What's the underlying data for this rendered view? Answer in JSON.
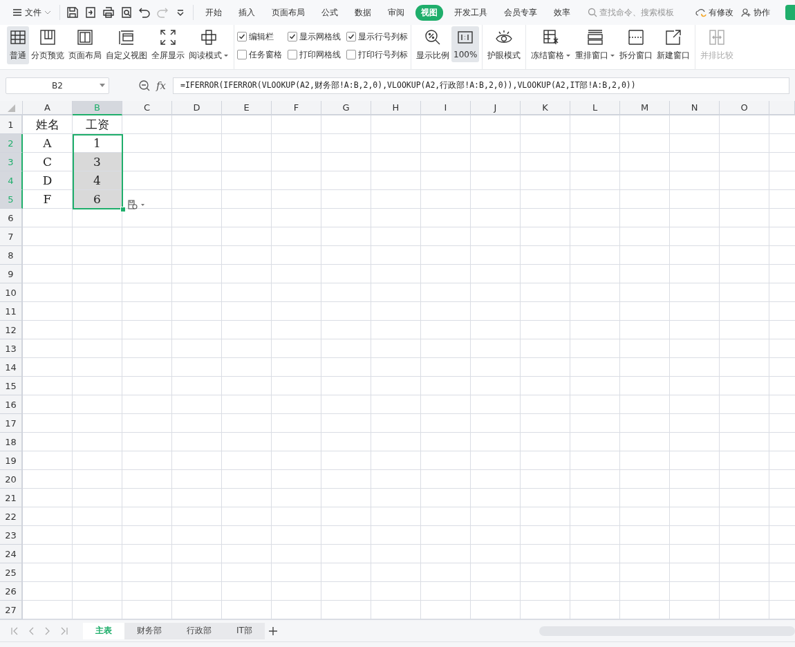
{
  "menu": {
    "file": "文件",
    "tabs": [
      {
        "label": "开始",
        "selected": false
      },
      {
        "label": "插入",
        "selected": false
      },
      {
        "label": "页面布局",
        "selected": false
      },
      {
        "label": "公式",
        "selected": false
      },
      {
        "label": "数据",
        "selected": false
      },
      {
        "label": "审阅",
        "selected": false
      },
      {
        "label": "视图",
        "selected": true
      },
      {
        "label": "开发工具",
        "selected": false
      },
      {
        "label": "会员专享",
        "selected": false
      },
      {
        "label": "效率",
        "selected": false
      }
    ],
    "search": {
      "placeholder": "查找命令、搜索模板"
    },
    "actions": [
      {
        "kind": "sync",
        "label": "有修改"
      },
      {
        "kind": "share",
        "label": "协作"
      }
    ]
  },
  "ribbon": {
    "groups": [
      {
        "kind": "buttons",
        "items": [
          {
            "kind": "grid",
            "label": "普通",
            "selected": true,
            "dropdown": false,
            "disabled": false
          },
          {
            "kind": "pagebreak",
            "label": "分页预览",
            "selected": false,
            "dropdown": false,
            "disabled": false
          },
          {
            "kind": "layout",
            "label": "页面布局",
            "selected": false,
            "dropdown": false,
            "disabled": false
          },
          {
            "kind": "custom",
            "label": "自定义视图",
            "selected": false,
            "dropdown": false,
            "disabled": false
          },
          {
            "kind": "fullscreen",
            "label": "全屏显示",
            "selected": false,
            "dropdown": false,
            "disabled": false
          },
          {
            "kind": "reading",
            "label": "阅读模式",
            "selected": false,
            "dropdown": true,
            "disabled": false
          }
        ]
      },
      {
        "kind": "checks",
        "items": [
          {
            "label": "编辑栏",
            "checked": true
          },
          {
            "label": "任务窗格",
            "checked": false
          },
          {
            "label": "显示网格线",
            "checked": true
          },
          {
            "label": "打印网格线",
            "checked": false
          },
          {
            "label": "显示行号列标",
            "checked": true
          },
          {
            "label": "打印行号列标",
            "checked": false
          }
        ]
      },
      {
        "kind": "buttons",
        "items": [
          {
            "kind": "zoom",
            "label": "显示比例",
            "selected": false,
            "dropdown": false,
            "disabled": false
          },
          {
            "kind": "actual",
            "label": "100%",
            "selected": true,
            "dropdown": false,
            "disabled": false
          }
        ]
      },
      {
        "kind": "buttons",
        "items": [
          {
            "kind": "eye",
            "label": "护眼模式",
            "selected": false,
            "dropdown": false,
            "disabled": false
          }
        ]
      },
      {
        "kind": "buttons",
        "items": [
          {
            "kind": "freeze",
            "label": "冻结窗格",
            "selected": false,
            "dropdown": true,
            "disabled": false
          },
          {
            "kind": "arrange",
            "label": "重排窗口",
            "selected": false,
            "dropdown": true,
            "disabled": false
          },
          {
            "kind": "split",
            "label": "拆分窗口",
            "selected": false,
            "dropdown": false,
            "disabled": false
          },
          {
            "kind": "newwin",
            "label": "新建窗口",
            "selected": false,
            "dropdown": false,
            "disabled": false
          }
        ]
      },
      {
        "kind": "buttons",
        "items": [
          {
            "kind": "compare",
            "label": "并排比较",
            "selected": false,
            "dropdown": false,
            "disabled": true
          }
        ]
      }
    ]
  },
  "formula_bar": {
    "name_box": "B2",
    "function_label": "fx",
    "formula": "=IFERROR(IFERROR(VLOOKUP(A2,财务部!A:B,2,0),VLOOKUP(A2,行政部!A:B,2,0)),VLOOKUP(A2,IT部!A:B,2,0))"
  },
  "sheet": {
    "columns": [
      {
        "label": "A",
        "selected": false
      },
      {
        "label": "B",
        "selected": true
      },
      {
        "label": "C",
        "selected": false
      },
      {
        "label": "D",
        "selected": false
      },
      {
        "label": "E",
        "selected": false
      },
      {
        "label": "F",
        "selected": false
      },
      {
        "label": "G",
        "selected": false
      },
      {
        "label": "H",
        "selected": false
      },
      {
        "label": "I",
        "selected": false
      },
      {
        "label": "J",
        "selected": false
      },
      {
        "label": "K",
        "selected": false
      },
      {
        "label": "L",
        "selected": false
      },
      {
        "label": "M",
        "selected": false
      },
      {
        "label": "N",
        "selected": false
      },
      {
        "label": "O",
        "selected": false
      }
    ],
    "rows": [
      {
        "number": "1",
        "selected": false,
        "cells": [
          {
            "text": "姓名",
            "selected": false
          },
          {
            "text": "工资",
            "selected": false
          }
        ]
      },
      {
        "number": "2",
        "selected": true,
        "cells": [
          {
            "text": "A",
            "selected": false
          },
          {
            "text": "1",
            "selected": false
          }
        ]
      },
      {
        "number": "3",
        "selected": true,
        "cells": [
          {
            "text": "C",
            "selected": false
          },
          {
            "text": "3",
            "selected": true
          }
        ]
      },
      {
        "number": "4",
        "selected": true,
        "cells": [
          {
            "text": "D",
            "selected": false
          },
          {
            "text": "4",
            "selected": true
          }
        ]
      },
      {
        "number": "5",
        "selected": true,
        "cells": [
          {
            "text": "F",
            "selected": false
          },
          {
            "text": "6",
            "selected": true
          }
        ]
      },
      {
        "number": "6",
        "selected": false,
        "cells": []
      },
      {
        "number": "7",
        "selected": false,
        "cells": []
      },
      {
        "number": "8",
        "selected": false,
        "cells": []
      },
      {
        "number": "9",
        "selected": false,
        "cells": []
      },
      {
        "number": "10",
        "selected": false,
        "cells": []
      },
      {
        "number": "11",
        "selected": false,
        "cells": []
      },
      {
        "number": "12",
        "selected": false,
        "cells": []
      },
      {
        "number": "13",
        "selected": false,
        "cells": []
      },
      {
        "number": "14",
        "selected": false,
        "cells": []
      },
      {
        "number": "15",
        "selected": false,
        "cells": []
      },
      {
        "number": "16",
        "selected": false,
        "cells": []
      },
      {
        "number": "17",
        "selected": false,
        "cells": []
      },
      {
        "number": "18",
        "selected": false,
        "cells": []
      },
      {
        "number": "19",
        "selected": false,
        "cells": []
      },
      {
        "number": "20",
        "selected": false,
        "cells": []
      },
      {
        "number": "21",
        "selected": false,
        "cells": []
      },
      {
        "number": "22",
        "selected": false,
        "cells": []
      },
      {
        "number": "23",
        "selected": false,
        "cells": []
      },
      {
        "number": "24",
        "selected": false,
        "cells": []
      },
      {
        "number": "25",
        "selected": false,
        "cells": []
      },
      {
        "number": "26",
        "selected": false,
        "cells": []
      },
      {
        "number": "27",
        "selected": false,
        "cells": []
      }
    ]
  },
  "sheet_tabs": [
    {
      "label": "主表",
      "selected": true
    },
    {
      "label": "财务部",
      "selected": false
    },
    {
      "label": "行政部",
      "selected": false
    },
    {
      "label": "IT部",
      "selected": false
    }
  ]
}
